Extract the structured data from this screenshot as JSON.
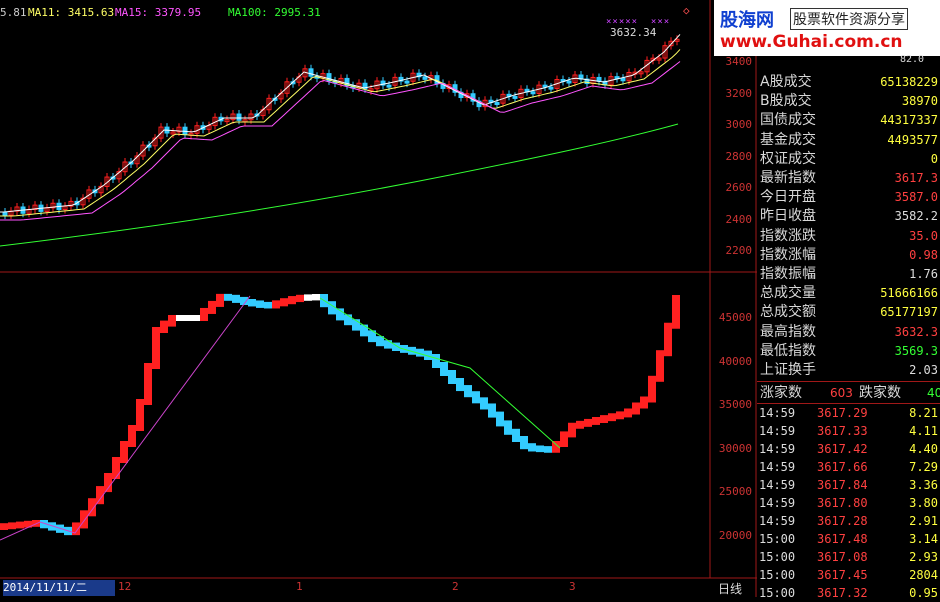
{
  "ma_legend": [
    {
      "text": "5.81",
      "color": "#ffffff"
    },
    {
      "text": "MA11: 3415.63",
      "color": "#ffff66"
    },
    {
      "text": "MA15: 3379.95",
      "color": "#ff55ff"
    },
    {
      "text": "MA100: 2995.31",
      "color": "#33ff33"
    }
  ],
  "upper_high_label": "3632.34",
  "upper_y_labels": [
    "3400",
    "3200",
    "3000",
    "2800",
    "2600",
    "2400",
    "2200"
  ],
  "lower_y_labels": [
    "45000",
    "40000",
    "35000",
    "30000",
    "25000",
    "20000"
  ],
  "x_axis": {
    "date_label": "2014/11/11/二",
    "months": [
      "12",
      "1",
      "2",
      "3"
    ],
    "period_label": "日线"
  },
  "watermark": {
    "brand": "股海网",
    "slogan": "股票软件资源分享",
    "url": "www.Guhai.com.cn",
    "partial_value": "82.0"
  },
  "stats": [
    {
      "label": "A股成交",
      "value": "65138229",
      "color": "#ffff40"
    },
    {
      "label": "B股成交",
      "value": "38970",
      "color": "#ffff40"
    },
    {
      "label": "国债成交",
      "value": "44317337",
      "color": "#ffff40"
    },
    {
      "label": "基金成交",
      "value": "4493577",
      "color": "#ffff40"
    },
    {
      "label": "权证成交",
      "value": "0",
      "color": "#ffff40"
    },
    {
      "label": "最新指数",
      "value": "3617.3",
      "color": "#ff4040"
    },
    {
      "label": "今日开盘",
      "value": "3587.0",
      "color": "#ff4040"
    },
    {
      "label": "昨日收盘",
      "value": "3582.2",
      "color": "#dddddd"
    },
    {
      "label": "指数涨跌",
      "value": "35.0",
      "color": "#ff4040"
    },
    {
      "label": "指数涨幅",
      "value": "0.98",
      "color": "#ff4040"
    },
    {
      "label": "指数振幅",
      "value": "1.76",
      "color": "#dddddd"
    },
    {
      "label": "总成交量",
      "value": "51666166",
      "color": "#ffff40"
    },
    {
      "label": "总成交额",
      "value": "65177197",
      "color": "#ffff40"
    },
    {
      "label": "最高指数",
      "value": "3632.3",
      "color": "#ff4040"
    },
    {
      "label": "最低指数",
      "value": "3569.3",
      "color": "#33ff33"
    },
    {
      "label": "上证换手",
      "value": "2.03",
      "color": "#dddddd"
    }
  ],
  "breadth": {
    "up_label": "涨家数",
    "up_value": "603",
    "down_label": "跌家数",
    "down_value": "40"
  },
  "ticks": [
    {
      "time": "14:59",
      "price": "3617.29",
      "vol": "8.21"
    },
    {
      "time": "14:59",
      "price": "3617.33",
      "vol": "4.11"
    },
    {
      "time": "14:59",
      "price": "3617.42",
      "vol": "4.40"
    },
    {
      "time": "14:59",
      "price": "3617.66",
      "vol": "7.29"
    },
    {
      "time": "14:59",
      "price": "3617.84",
      "vol": "3.36"
    },
    {
      "time": "14:59",
      "price": "3617.80",
      "vol": "3.80"
    },
    {
      "time": "14:59",
      "price": "3617.28",
      "vol": "2.91"
    },
    {
      "time": "15:00",
      "price": "3617.48",
      "vol": "3.14"
    },
    {
      "time": "15:00",
      "price": "3617.08",
      "vol": "2.93"
    },
    {
      "time": "15:00",
      "price": "3617.45",
      "vol": "2804"
    },
    {
      "time": "15:00",
      "price": "3617.32",
      "vol": "0.95"
    }
  ],
  "colors": {
    "grid": "#a01818",
    "up": "#ff2020",
    "down": "#33ccff",
    "ma5": "#ffffff",
    "ma11": "#ffff66",
    "ma15": "#ff55ff",
    "ma100": "#33ff33",
    "signal": "#cc44cc"
  }
}
